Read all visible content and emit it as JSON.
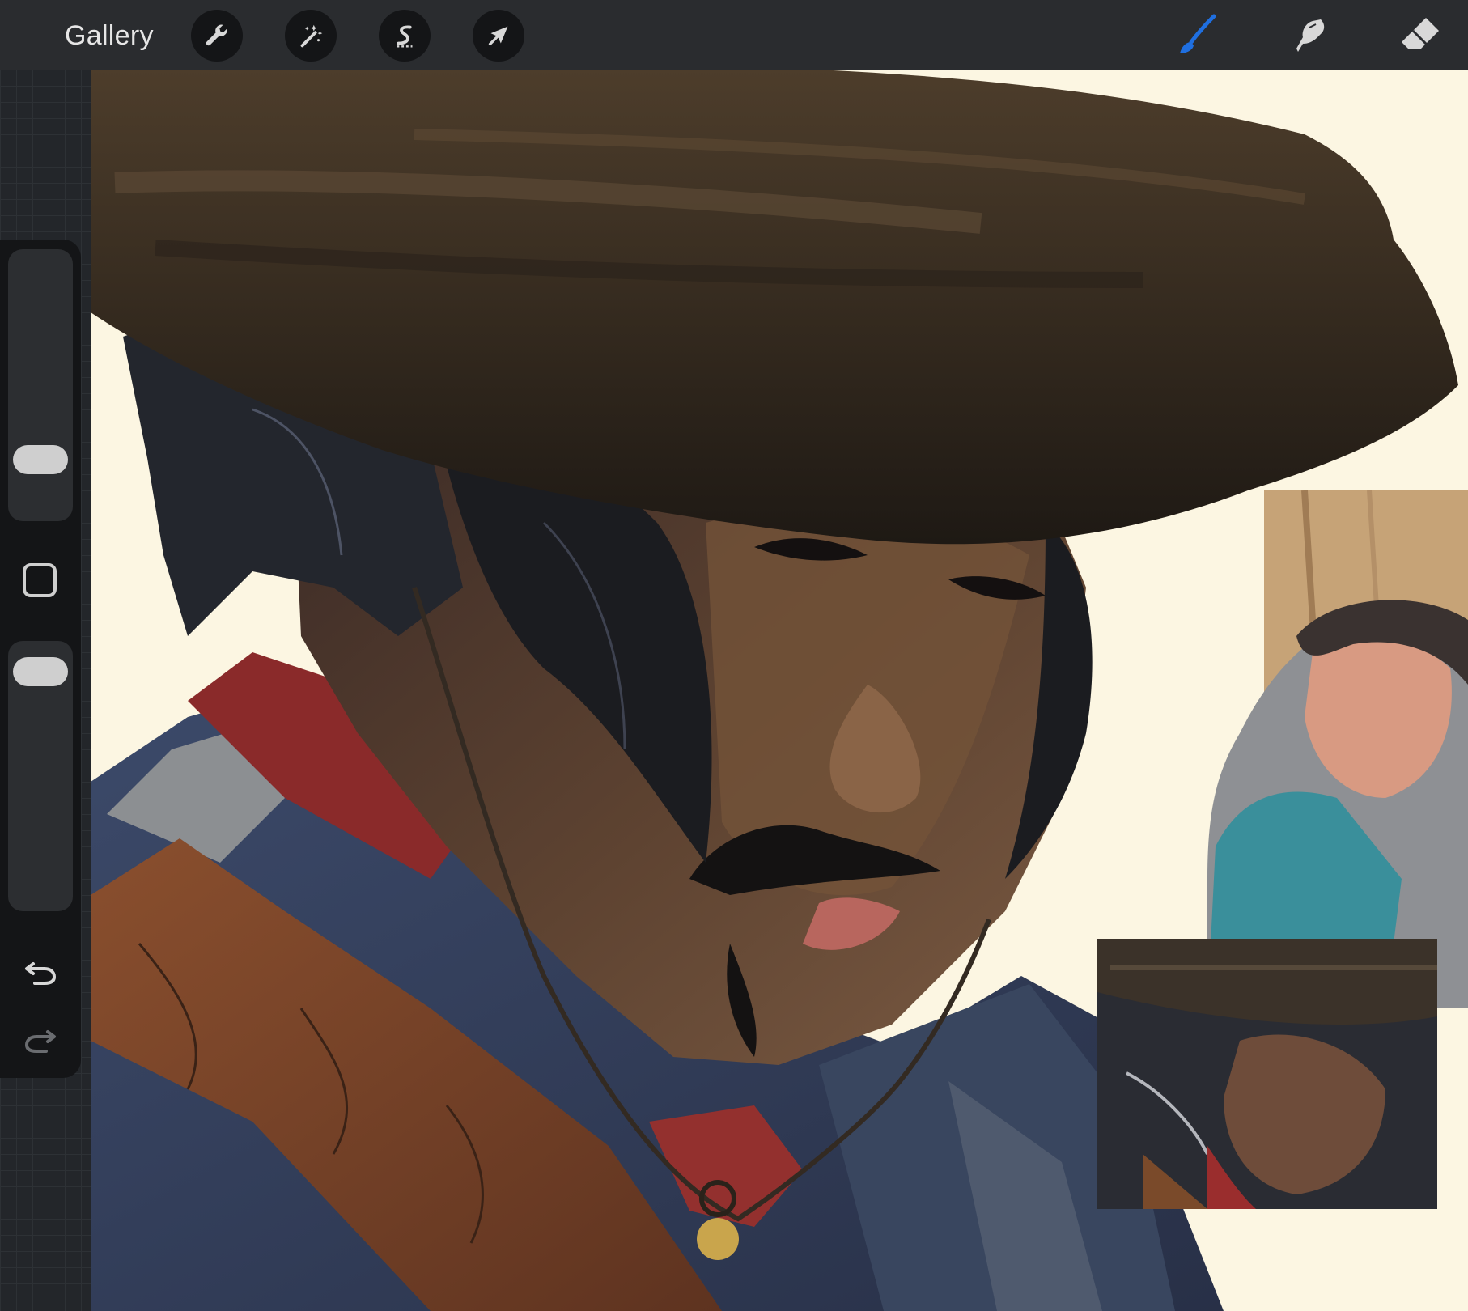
{
  "toolbar": {
    "gallery_label": "Gallery",
    "left_tools": [
      {
        "name": "actions-wrench-icon"
      },
      {
        "name": "adjustments-magic-wand-icon"
      },
      {
        "name": "selection-s-icon"
      },
      {
        "name": "transform-arrow-icon"
      }
    ],
    "right_tools": [
      {
        "name": "brush-icon",
        "active": true
      },
      {
        "name": "smudge-icon",
        "active": false
      },
      {
        "name": "eraser-icon",
        "active": false
      }
    ]
  },
  "sidebar": {
    "brush_size_level": 0.18,
    "brush_opacity_level": 0.95,
    "modify_icon": "square-icon",
    "undo_icon": "undo-arrow-icon",
    "redo_icon": "redo-arrow-icon"
  },
  "colors": {
    "toolbar_bg": "#2a2c2f",
    "sidebar_bg": "#141517",
    "canvas_bg": "#fcf6e2",
    "active_tool": "#1f6fe0",
    "icon_color": "#d8d8d8"
  },
  "canvas": {
    "description_icon": "painting-canvas"
  }
}
